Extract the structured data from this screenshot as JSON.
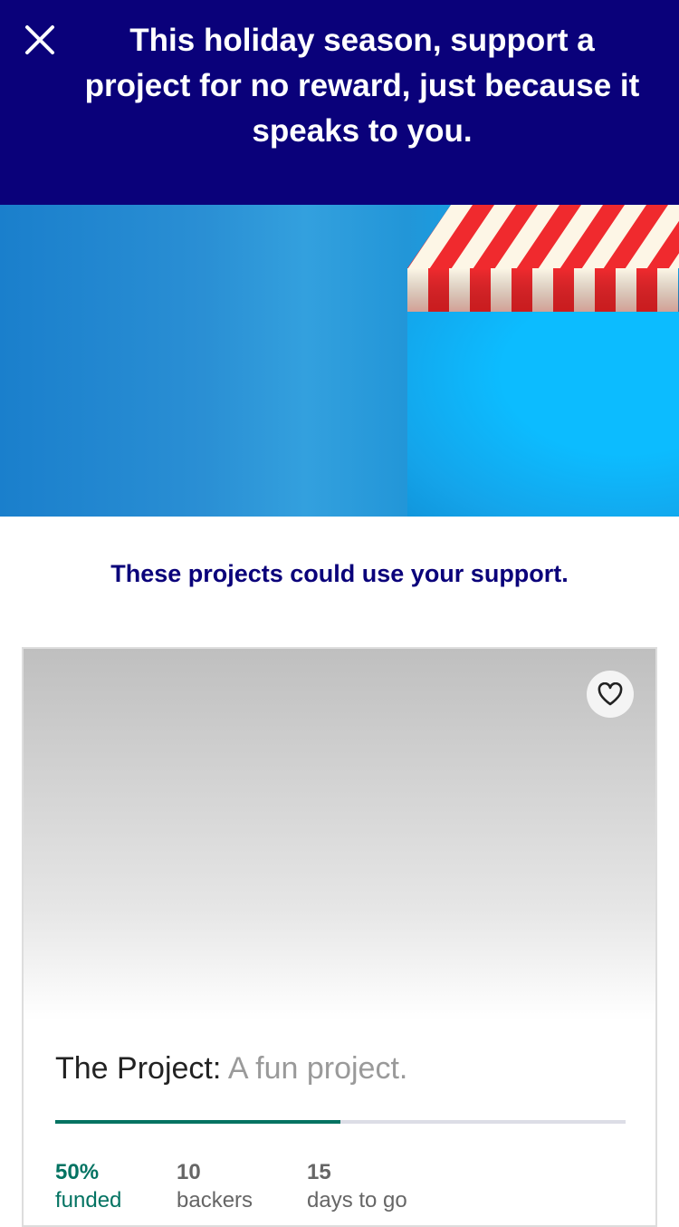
{
  "banner": {
    "message": "This holiday season, support a project for no reward, just because it speaks to you.",
    "close_icon": "close-icon"
  },
  "colors": {
    "banner": "#0a017a",
    "accent": "#037362"
  },
  "section": {
    "heading": "These projects could use your support."
  },
  "project": {
    "name": "The Project:",
    "blurb": "A fun project.",
    "funded_fraction": 0.5,
    "stats": [
      {
        "value": "50%",
        "label": "funded"
      },
      {
        "value": "10",
        "label": "backers"
      },
      {
        "value": "15",
        "label": "days to go"
      }
    ]
  }
}
